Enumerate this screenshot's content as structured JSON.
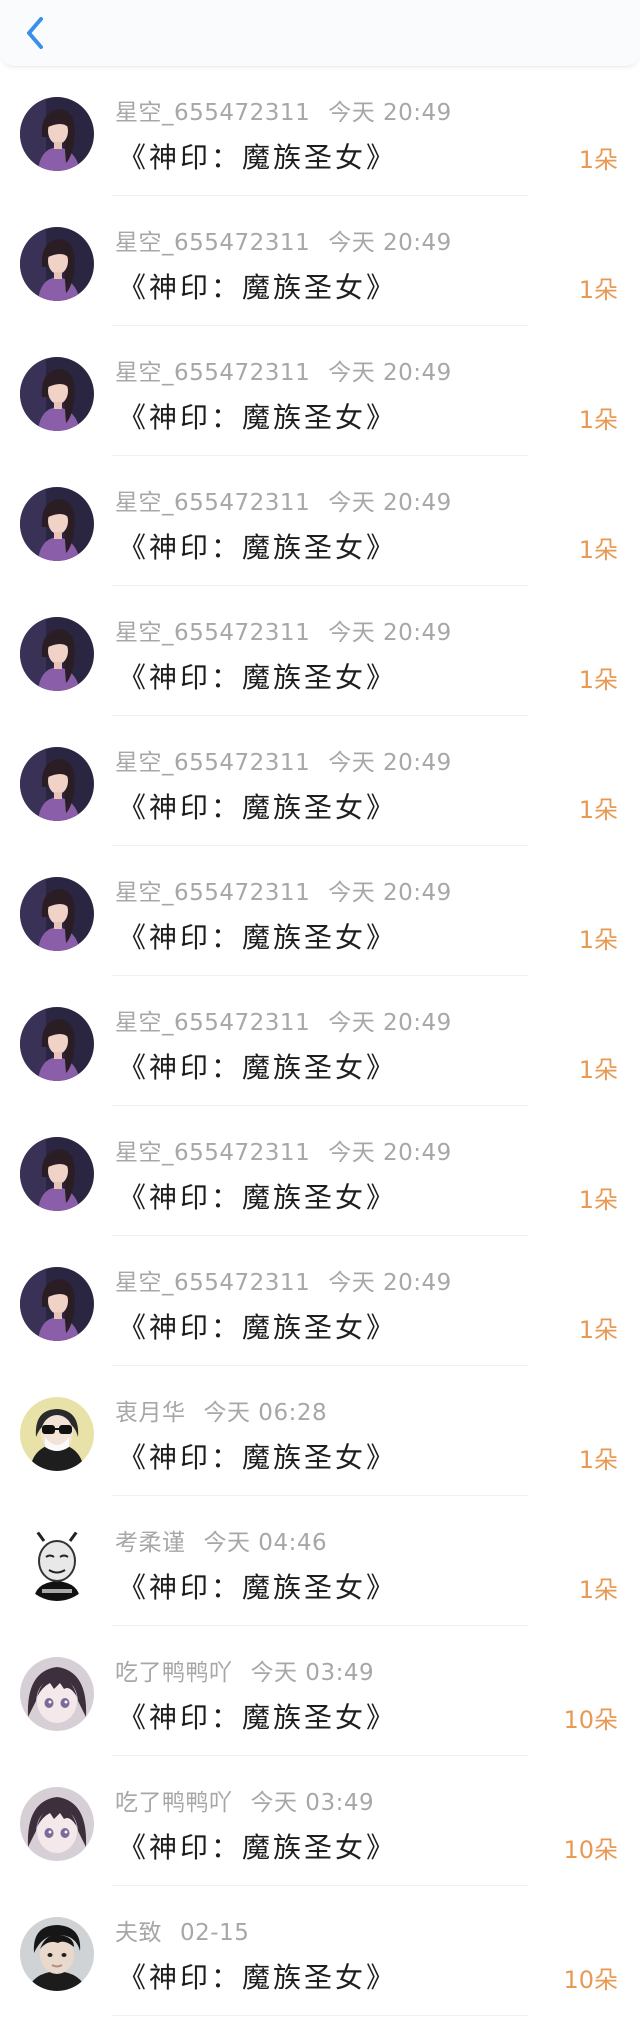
{
  "header": {
    "back_icon": "chevron-left-icon",
    "accent": "#3a8fe8"
  },
  "colors": {
    "amount": "#e89a55",
    "meta": "#a7a7a7",
    "title": "#1e1e1e"
  },
  "items": [
    {
      "name": "星空_655472311",
      "time": "今天 20:49",
      "title": "《神印：魔族圣女》",
      "amount": "1朵",
      "avatar": "girl"
    },
    {
      "name": "星空_655472311",
      "time": "今天 20:49",
      "title": "《神印：魔族圣女》",
      "amount": "1朵",
      "avatar": "girl"
    },
    {
      "name": "星空_655472311",
      "time": "今天 20:49",
      "title": "《神印：魔族圣女》",
      "amount": "1朵",
      "avatar": "girl"
    },
    {
      "name": "星空_655472311",
      "time": "今天 20:49",
      "title": "《神印：魔族圣女》",
      "amount": "1朵",
      "avatar": "girl"
    },
    {
      "name": "星空_655472311",
      "time": "今天 20:49",
      "title": "《神印：魔族圣女》",
      "amount": "1朵",
      "avatar": "girl"
    },
    {
      "name": "星空_655472311",
      "time": "今天 20:49",
      "title": "《神印：魔族圣女》",
      "amount": "1朵",
      "avatar": "girl"
    },
    {
      "name": "星空_655472311",
      "time": "今天 20:49",
      "title": "《神印：魔族圣女》",
      "amount": "1朵",
      "avatar": "girl"
    },
    {
      "name": "星空_655472311",
      "time": "今天 20:49",
      "title": "《神印：魔族圣女》",
      "amount": "1朵",
      "avatar": "girl"
    },
    {
      "name": "星空_655472311",
      "time": "今天 20:49",
      "title": "《神印：魔族圣女》",
      "amount": "1朵",
      "avatar": "girl"
    },
    {
      "name": "星空_655472311",
      "time": "今天 20:49",
      "title": "《神印：魔族圣女》",
      "amount": "1朵",
      "avatar": "girl"
    },
    {
      "name": "衷月华",
      "time": "今天 06:28",
      "title": "《神印：魔族圣女》",
      "amount": "1朵",
      "avatar": "sunglasses"
    },
    {
      "name": "考柔谨",
      "time": "今天 04:46",
      "title": "《神印：魔族圣女》",
      "amount": "1朵",
      "avatar": "meme"
    },
    {
      "name": "吃了鸭鸭吖",
      "time": "今天 03:49",
      "title": "《神印：魔族圣女》",
      "amount": "10朵",
      "avatar": "anime"
    },
    {
      "name": "吃了鸭鸭吖",
      "time": "今天 03:49",
      "title": "《神印：魔族圣女》",
      "amount": "10朵",
      "avatar": "anime"
    },
    {
      "name": "夫致",
      "time": "02-15",
      "title": "《神印：魔族圣女》",
      "amount": "10朵",
      "avatar": "boy"
    }
  ]
}
